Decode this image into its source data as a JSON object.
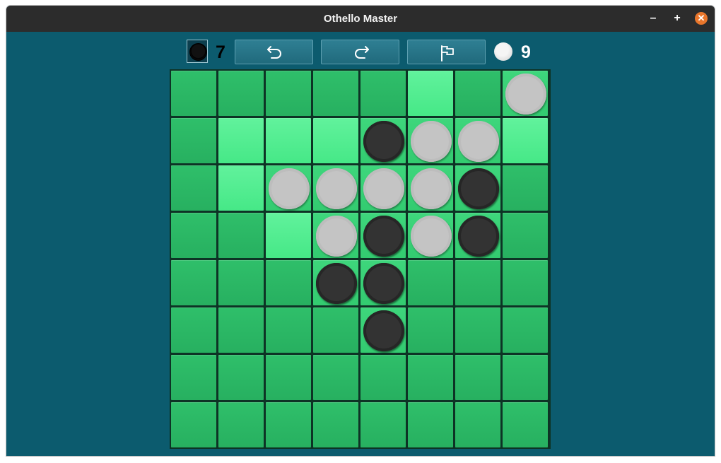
{
  "window": {
    "title": "Othello Master"
  },
  "scores": {
    "black": "7",
    "white": "9"
  },
  "toolbar": {
    "buttons": [
      {
        "name": "undo-button",
        "icon": "undo-arrow-icon"
      },
      {
        "name": "redo-button",
        "icon": "redo-arrow-icon"
      },
      {
        "name": "resign-button",
        "icon": "flag-icon"
      }
    ]
  },
  "board": {
    "size": 8,
    "rows": [
      "-----+-W",
      "-+++BWW+",
      "-+WWWWB-",
      "--+WBWB-",
      "---BB---",
      "----B---",
      "--------",
      "--------"
    ],
    "legend": {
      "B": "black",
      "W": "white",
      "+": "highlighted-empty",
      "-": "empty"
    },
    "colors": {
      "cell": "#2fbf6a",
      "highlight": "#58ef96",
      "black_piece": "#2b2b2b",
      "white_piece": "#bdbdbd",
      "background": "#0c5b6e"
    }
  }
}
